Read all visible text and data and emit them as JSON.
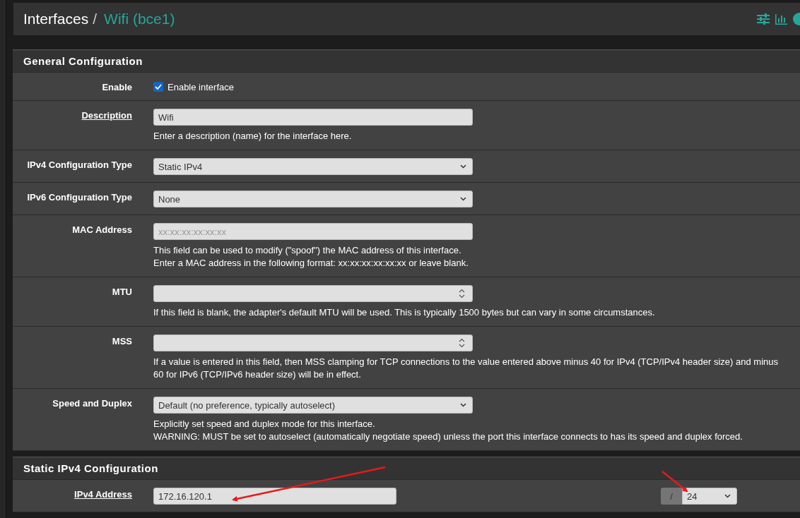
{
  "breadcrumb": {
    "parent": "Interfaces",
    "separator": "/",
    "current": "Wifi (bce1)"
  },
  "sections": [
    {
      "title": "General Configuration",
      "rows": [
        {
          "kind": "checkbox",
          "label": "Enable",
          "link": false,
          "checked": true,
          "option": "Enable interface"
        },
        {
          "kind": "text",
          "label": "Description",
          "link": true,
          "value": "Wifi",
          "help": [
            "Enter a description (name) for the interface here."
          ]
        },
        {
          "kind": "select",
          "label": "IPv4 Configuration Type",
          "link": false,
          "value": "Static IPv4"
        },
        {
          "kind": "select",
          "label": "IPv6 Configuration Type",
          "link": false,
          "value": "None"
        },
        {
          "kind": "text",
          "label": "MAC Address",
          "link": false,
          "placeholder": "xx:xx:xx:xx:xx:xx",
          "help": [
            "This field can be used to modify (\"spoof\") the MAC address of this interface.",
            "Enter a MAC address in the following format: xx:xx:xx:xx:xx:xx or leave blank."
          ]
        },
        {
          "kind": "number",
          "label": "MTU",
          "link": false,
          "help": [
            "If this field is blank, the adapter's default MTU will be used. This is typically 1500 bytes but can vary in some circumstances."
          ]
        },
        {
          "kind": "number",
          "label": "MSS",
          "link": false,
          "help": [
            "If a value is entered in this field, then MSS clamping for TCP connections to the value entered above minus 40 for IPv4 (TCP/IPv4 header size) and minus 60 for IPv6 (TCP/IPv6 header size) will be in effect."
          ]
        },
        {
          "kind": "select",
          "label": "Speed and Duplex",
          "link": false,
          "value": "Default (no preference, typically autoselect)",
          "help": [
            "Explicitly set speed and duplex mode for this interface.",
            "WARNING: MUST be set to autoselect (automatically negotiate speed) unless the port this interface connects to has its speed and duplex forced."
          ]
        }
      ]
    },
    {
      "title": "Static IPv4 Configuration",
      "rows": [
        {
          "kind": "address",
          "label": "IPv4 Address",
          "link": true,
          "value": "172.16.120.1",
          "addon": "/",
          "mask": "24"
        }
      ]
    }
  ]
}
